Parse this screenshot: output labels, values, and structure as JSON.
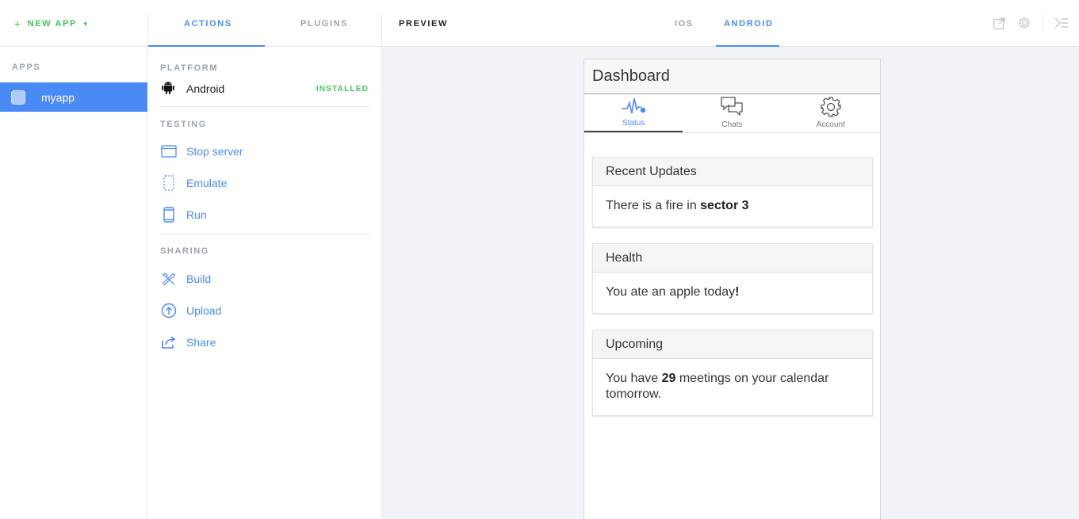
{
  "topbar": {
    "new_app_plus": "+",
    "new_app_label": "NEW APP",
    "new_app_caret": "▼",
    "tabs": {
      "actions": "ACTIONS",
      "plugins": "PLUGINS"
    },
    "preview_label": "PREVIEW",
    "platform_tabs": {
      "ios": "IOS",
      "android": "ANDROID"
    },
    "icons": [
      "external-link-icon",
      "gear-icon",
      "collapse-panel-icon"
    ]
  },
  "sidebar": {
    "apps_label": "APPS",
    "apps": [
      {
        "name": "myapp",
        "selected": true
      }
    ]
  },
  "actions": {
    "platform_label": "PLATFORM",
    "platform": {
      "name": "Android",
      "status": "INSTALLED",
      "icon": "android-icon"
    },
    "testing_label": "TESTING",
    "testing": [
      {
        "label": "Stop server",
        "icon": "browser-window-icon"
      },
      {
        "label": "Emulate",
        "icon": "dashed-phone-icon"
      },
      {
        "label": "Run",
        "icon": "phone-icon"
      }
    ],
    "sharing_label": "SHARING",
    "sharing": [
      {
        "label": "Build",
        "icon": "tools-icon"
      },
      {
        "label": "Upload",
        "icon": "upload-icon"
      },
      {
        "label": "Share",
        "icon": "share-icon"
      }
    ]
  },
  "device": {
    "header_title": "Dashboard",
    "tabs": [
      {
        "label": "Status",
        "icon": "pulse-icon",
        "active": true
      },
      {
        "label": "Chats",
        "icon": "chat-bubbles-icon",
        "active": false
      },
      {
        "label": "Account",
        "icon": "gear-icon",
        "active": false
      }
    ],
    "cards": [
      {
        "title": "Recent Updates",
        "body_prefix": "There is a fire in ",
        "body_bold": "sector 3",
        "body_suffix": ""
      },
      {
        "title": "Health",
        "body_prefix": "You ate an apple today",
        "body_bold": "!",
        "body_suffix": ""
      },
      {
        "title": "Upcoming",
        "body_prefix": "You have ",
        "body_bold": "29",
        "body_suffix": " meetings on your calendar tomorrow."
      }
    ]
  },
  "colors": {
    "accent": "#4a8af4",
    "installed": "#3fc45a",
    "new_app": "#3fc45a",
    "preview_bg": "#f2f3f7"
  }
}
